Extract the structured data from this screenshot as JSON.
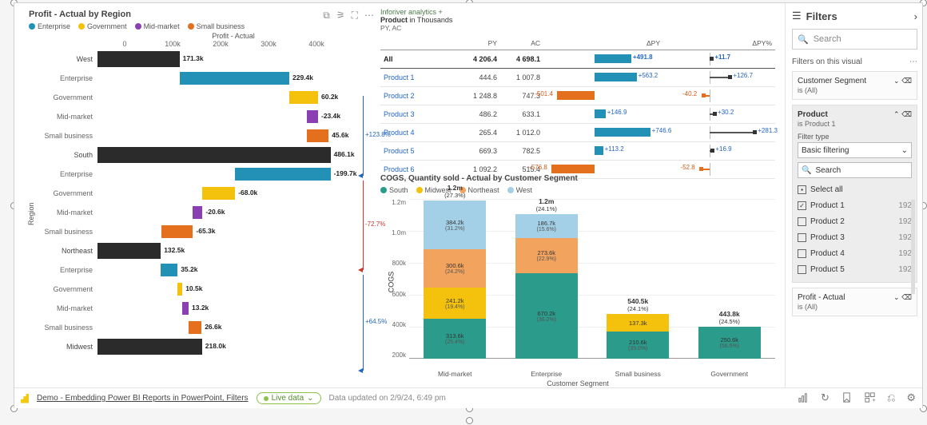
{
  "colors": {
    "enterprise": "#2391b5",
    "government": "#f4c20d",
    "mid_market": "#8a3fb3",
    "small_business": "#e4701e",
    "total": "#2b2b2b",
    "south": "#2b9b8c",
    "midwest_c": "#f4c20d",
    "northeast_c": "#f2a35e",
    "west_c": "#a3d0e6"
  },
  "left_visual": {
    "title": "Profit - Actual by Region",
    "axis_title": "Profit - Actual",
    "y_axis_label": "Region",
    "legend": [
      "Enterprise",
      "Government",
      "Mid-market",
      "Small business"
    ],
    "x_ticks": [
      "0",
      "100k",
      "200k",
      "300k",
      "400k"
    ]
  },
  "chart_data": [
    {
      "type": "bar",
      "title": "Profit - Actual by Region",
      "xlabel": "Profit - Actual",
      "ylabel": "Region",
      "x_ticks": [
        0,
        100000,
        200000,
        300000,
        400000
      ],
      "structure": "waterfall-by-region-with-segment-breakdown",
      "regions": [
        {
          "name": "West",
          "total": 171300,
          "segments": {
            "Enterprise": 229400,
            "Government": 60200,
            "Mid-market": -23400,
            "Small business": 45600
          },
          "variance_to_next_pct": 123.8
        },
        {
          "name": "South",
          "total": 486100,
          "segments": {
            "Enterprise": -199700,
            "Government": -68000,
            "Mid-market": -20600,
            "Small business": -65300
          },
          "variance_to_next_pct": -72.7
        },
        {
          "name": "Northeast",
          "total": 132500,
          "segments": {
            "Enterprise": 35200,
            "Government": 10500,
            "Mid-market": 13200,
            "Small business": 26600
          },
          "variance_to_next_pct": 64.5
        },
        {
          "name": "Midwest",
          "total": 218000
        }
      ]
    },
    {
      "type": "table-with-variance-bars",
      "title": "Product in Thousands",
      "subtitle": "PY, AC",
      "columns": [
        "",
        "PY",
        "AC",
        "ΔPY",
        "ΔPY%"
      ],
      "rows": [
        {
          "label": "All",
          "py": 4206.4,
          "ac": 4698.1,
          "dpy": 491.8,
          "dpy_pct": 11.7
        },
        {
          "label": "Product 1",
          "py": 444.6,
          "ac": 1007.8,
          "dpy": 563.2,
          "dpy_pct": 126.7
        },
        {
          "label": "Product 2",
          "py": 1248.8,
          "ac": 747.3,
          "dpy": -501.4,
          "dpy_pct": -40.2
        },
        {
          "label": "Product 3",
          "py": 486.2,
          "ac": 633.1,
          "dpy": 146.9,
          "dpy_pct": 30.2
        },
        {
          "label": "Product 4",
          "py": 265.4,
          "ac": 1012.0,
          "dpy": 746.6,
          "dpy_pct": 281.3
        },
        {
          "label": "Product 5",
          "py": 669.3,
          "ac": 782.5,
          "dpy": 113.2,
          "dpy_pct": 16.9
        },
        {
          "label": "Product 6",
          "py": 1092.2,
          "ac": 515.4,
          "dpy": -576.8,
          "dpy_pct": -52.8
        }
      ]
    },
    {
      "type": "stacked-bar",
      "title": "COGS, Quantity sold - Actual by Customer Segment",
      "xlabel": "Customer Segment",
      "ylabel": "COGS",
      "y_ticks": [
        "1.2m",
        "1.0m",
        "800k",
        "600k",
        "400k",
        "200k"
      ],
      "legend": [
        "South",
        "Midwest",
        "Northeast",
        "West"
      ],
      "categories": [
        "Mid-market",
        "Enterprise",
        "Small business",
        "Government"
      ],
      "totals": [
        {
          "value": "1.2m",
          "pct": "27.3%"
        },
        {
          "value": "1.2m",
          "pct": "24.1%"
        },
        {
          "value": "540.5k",
          "pct": "24.1%"
        },
        {
          "value": "443.8k",
          "pct": "24.5%"
        }
      ],
      "series": [
        {
          "name": "South",
          "values_label": [
            "313.6k (25.4%)",
            "670.2k (36.2%)",
            "210.6k (39.0%)",
            "250.6k (56.5%)"
          ]
        },
        {
          "name": "Midwest",
          "values_label": [
            "241.2k (19.4%)",
            null,
            "137.3k (25.4%)",
            null
          ]
        },
        {
          "name": "Northeast",
          "values_label": [
            "300.6k (24.2%)",
            "273.6k (22.9%)",
            null,
            null
          ]
        },
        {
          "name": "West",
          "values_label": [
            "384.2k (31.2%)",
            "186.7k (15.6%)",
            null,
            null
          ]
        }
      ]
    }
  ],
  "left_rows": [
    {
      "lbl": "West",
      "kind": "total",
      "val": "171.3k",
      "start": 0,
      "end": 171
    },
    {
      "lbl": "Enterprise",
      "kind": "ent",
      "val": "229.4k",
      "start": 171,
      "end": 400
    },
    {
      "lbl": "Government",
      "kind": "gov",
      "val": "60.2k",
      "start": 400,
      "end": 460
    },
    {
      "lbl": "Mid-market",
      "kind": "mm",
      "val": "-23.4k",
      "start": 437,
      "end": 460
    },
    {
      "lbl": "Small business",
      "kind": "sb",
      "val": "45.6k",
      "start": 437,
      "end": 482
    },
    {
      "lbl": "South",
      "kind": "total",
      "val": "486.1k",
      "start": 0,
      "end": 486
    },
    {
      "lbl": "Enterprise",
      "kind": "ent",
      "val": "-199.7k",
      "start": 287,
      "end": 486
    },
    {
      "lbl": "Government",
      "kind": "gov",
      "val": "-68.0k",
      "start": 219,
      "end": 287
    },
    {
      "lbl": "Mid-market",
      "kind": "mm",
      "val": "-20.6k",
      "start": 199,
      "end": 219
    },
    {
      "lbl": "Small business",
      "kind": "sb",
      "val": "-65.3k",
      "start": 134,
      "end": 199
    },
    {
      "lbl": "Northeast",
      "kind": "total",
      "val": "132.5k",
      "start": 0,
      "end": 132
    },
    {
      "lbl": "Enterprise",
      "kind": "ent",
      "val": "35.2k",
      "start": 132,
      "end": 167
    },
    {
      "lbl": "Government",
      "kind": "gov",
      "val": "10.5k",
      "start": 167,
      "end": 177
    },
    {
      "lbl": "Mid-market",
      "kind": "mm",
      "val": "13.2k",
      "start": 177,
      "end": 190
    },
    {
      "lbl": "Small business",
      "kind": "sb",
      "val": "26.6k",
      "start": 190,
      "end": 217
    },
    {
      "lbl": "Midwest",
      "kind": "total",
      "val": "218.0k",
      "start": 0,
      "end": 218
    }
  ],
  "left_variances": [
    {
      "label": "+123.8%",
      "color": "blue"
    },
    {
      "label": "-72.7%",
      "color": "red"
    },
    {
      "label": "+64.5%",
      "color": "blue"
    }
  ],
  "top_right": {
    "brand": "Inforiver analytics +",
    "title_a": "Product",
    "title_b": " in Thousands",
    "sub": "PY, AC",
    "cols": [
      "",
      "PY",
      "AC",
      "ΔPY",
      "ΔPY%"
    ]
  },
  "tr_rows": [
    {
      "lbl": "All",
      "py": "4 206.4",
      "ac": "4 698.1",
      "dpy": 491.8,
      "dpyp": 11.7,
      "all": true
    },
    {
      "lbl": "Product 1",
      "py": "444.6",
      "ac": "1 007.8",
      "dpy": 563.2,
      "dpyp": 126.7
    },
    {
      "lbl": "Product 2",
      "py": "1 248.8",
      "ac": "747.3",
      "dpy": -501.4,
      "dpyp": -40.2
    },
    {
      "lbl": "Product 3",
      "py": "486.2",
      "ac": "633.1",
      "dpy": 146.9,
      "dpyp": 30.2
    },
    {
      "lbl": "Product 4",
      "py": "265.4",
      "ac": "1 012.0",
      "dpy": 746.6,
      "dpyp": 281.3
    },
    {
      "lbl": "Product 5",
      "py": "669.3",
      "ac": "782.5",
      "dpy": 113.2,
      "dpyp": 16.9
    },
    {
      "lbl": "Product 6",
      "py": "1 092.2",
      "ac": "515.4",
      "dpy": -576.8,
      "dpyp": -52.8
    }
  ],
  "br": {
    "title": "COGS, Quantity sold - Actual by Customer Segment",
    "legend": [
      "South",
      "Midwest",
      "Northeast",
      "West"
    ],
    "y_label": "COGS",
    "x_label": "Customer Segment",
    "y_ticks": [
      "1.2m",
      "1.0m",
      "800k",
      "600k",
      "400k",
      "200k"
    ],
    "cats": [
      "Mid-market",
      "Enterprise",
      "Small business",
      "Government"
    ]
  },
  "br_cols": [
    {
      "tot": "1.2m",
      "pct": "(27.3%)",
      "top": -18,
      "segs": [
        {
          "c": "south",
          "h": 50,
          "l1": "313.6k",
          "l2": "(25.4%)"
        },
        {
          "c": "mw",
          "h": 39,
          "l1": "241.2k",
          "l2": "(19.4%)"
        },
        {
          "c": "ne",
          "h": 48,
          "l1": "300.6k",
          "l2": "(24.2%)"
        },
        {
          "c": "west",
          "h": 61,
          "l1": "384.2k",
          "l2": "(31.2%)"
        }
      ]
    },
    {
      "tot": "1.2m",
      "pct": "(24.1%)",
      "top": -18,
      "segs": [
        {
          "c": "south",
          "h": 107,
          "l1": "670.2k",
          "l2": "(36.2%)"
        },
        {
          "c": "ne",
          "h": 44,
          "l1": "273.6k",
          "l2": "(22.9%)"
        },
        {
          "c": "west",
          "h": 30,
          "l1": "186.7k",
          "l2": "(15.6%)"
        }
      ]
    },
    {
      "tot": "540.5k",
      "pct": "(24.1%)",
      "top": 100,
      "segs": [
        {
          "c": "south",
          "h": 34,
          "l1": "210.6k",
          "l2": "(39.0%)"
        },
        {
          "c": "mw",
          "h": 22,
          "l1": "137.3k",
          "l2": "(25.4%)"
        }
      ]
    },
    {
      "tot": "443.8k",
      "pct": "(24.5%)",
      "top": 118,
      "segs": [
        {
          "c": "south",
          "h": 40,
          "l1": "250.6k",
          "l2": "(56.5%)"
        }
      ]
    }
  ],
  "filters": {
    "title": "Filters",
    "search_ph": "Search",
    "section": "Filters on this visual",
    "card1": {
      "title": "Customer Segment",
      "sub": "is (All)"
    },
    "card2": {
      "title": "Product",
      "sub": "is Product 1",
      "type_lbl": "Filter type",
      "type_val": "Basic filtering",
      "search_ph": "Search",
      "items": [
        {
          "lbl": "Select all",
          "count": "",
          "state": "mixed"
        },
        {
          "lbl": "Product 1",
          "count": "192",
          "state": "checked"
        },
        {
          "lbl": "Product 2",
          "count": "192",
          "state": ""
        },
        {
          "lbl": "Product 3",
          "count": "192",
          "state": ""
        },
        {
          "lbl": "Product 4",
          "count": "192",
          "state": ""
        },
        {
          "lbl": "Product 5",
          "count": "192",
          "state": ""
        }
      ]
    },
    "card3": {
      "title": "Profit - Actual",
      "sub": "is (All)"
    }
  },
  "footer": {
    "link": "Demo - Embedding Power BI Reports in PowerPoint, Filters",
    "live": "Live data",
    "updated": "Data updated on 2/9/24, 6:49 pm"
  }
}
